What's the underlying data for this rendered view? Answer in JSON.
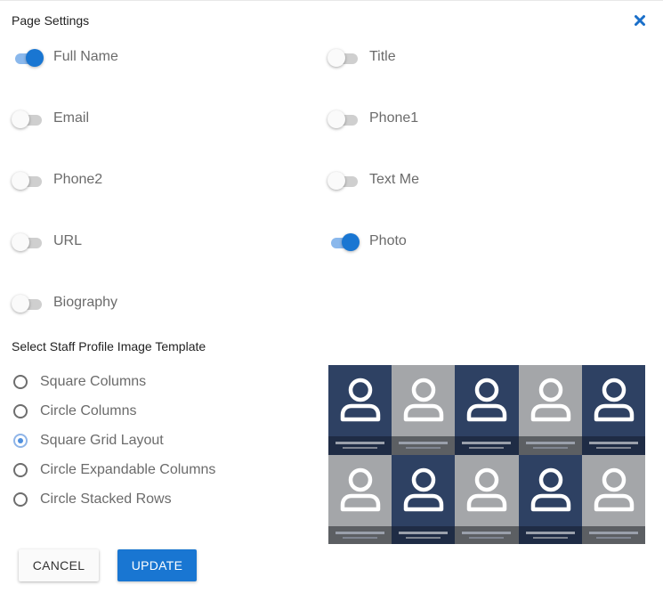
{
  "dialog": {
    "title": "Page Settings",
    "close_icon": "close-icon"
  },
  "colors": {
    "accent": "#1976d2",
    "toggle_on_track": "#8ab8ec",
    "toggle_off_track": "#cfcfcf",
    "tile_dark": "#2e4163",
    "tile_light": "#a4a6a9"
  },
  "toggles": [
    {
      "key": "full_name",
      "label": "Full Name",
      "on": true
    },
    {
      "key": "title",
      "label": "Title",
      "on": false
    },
    {
      "key": "email",
      "label": "Email",
      "on": false
    },
    {
      "key": "phone1",
      "label": "Phone1",
      "on": false
    },
    {
      "key": "phone2",
      "label": "Phone2",
      "on": false
    },
    {
      "key": "text_me",
      "label": "Text Me",
      "on": false
    },
    {
      "key": "url",
      "label": "URL",
      "on": false
    },
    {
      "key": "photo",
      "label": "Photo",
      "on": true
    },
    {
      "key": "biography",
      "label": "Biography",
      "on": false
    }
  ],
  "template_section": {
    "label": "Select Staff Profile Image Template",
    "selected": "Square Grid Layout",
    "options": [
      {
        "label": "Square Columns",
        "checked": false
      },
      {
        "label": "Circle Columns",
        "checked": false
      },
      {
        "label": "Square Grid Layout",
        "checked": true
      },
      {
        "label": "Circle Expandable Columns",
        "checked": false
      },
      {
        "label": "Circle Stacked Rows",
        "checked": false
      }
    ],
    "preview": {
      "rows": 2,
      "columns": 5,
      "tile_icon": "person-icon",
      "tiles": [
        "dark",
        "light",
        "dark",
        "light",
        "dark",
        "light",
        "dark",
        "light",
        "dark",
        "light"
      ]
    }
  },
  "actions": {
    "cancel_label": "CANCEL",
    "update_label": "UPDATE"
  }
}
